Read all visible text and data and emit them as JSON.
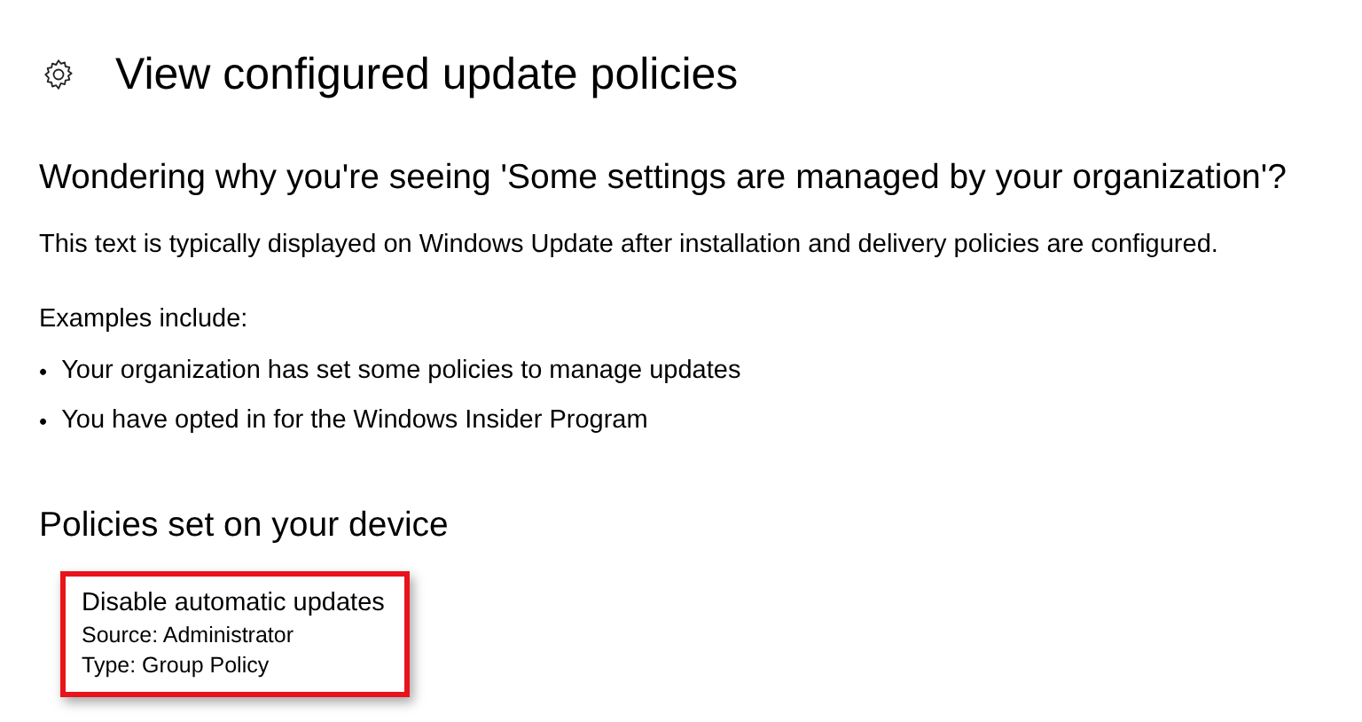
{
  "window": {
    "title": "View configured update policies"
  },
  "info": {
    "heading": "Wondering why you're seeing 'Some settings are managed by your organization'?",
    "text": "This text is typically displayed on Windows Update after installation and delivery policies are configured.",
    "examples_label": "Examples include:",
    "examples": [
      {
        "bullet": "•",
        "text": "Your organization has set some policies to manage updates"
      },
      {
        "bullet": "•",
        "text": "You have opted in for the Windows Insider Program"
      }
    ]
  },
  "policies": {
    "heading": "Policies set on your device",
    "items": [
      {
        "name": "Disable automatic updates",
        "source": "Source: Administrator",
        "type": "Type: Group Policy",
        "highlighted": true
      }
    ]
  }
}
